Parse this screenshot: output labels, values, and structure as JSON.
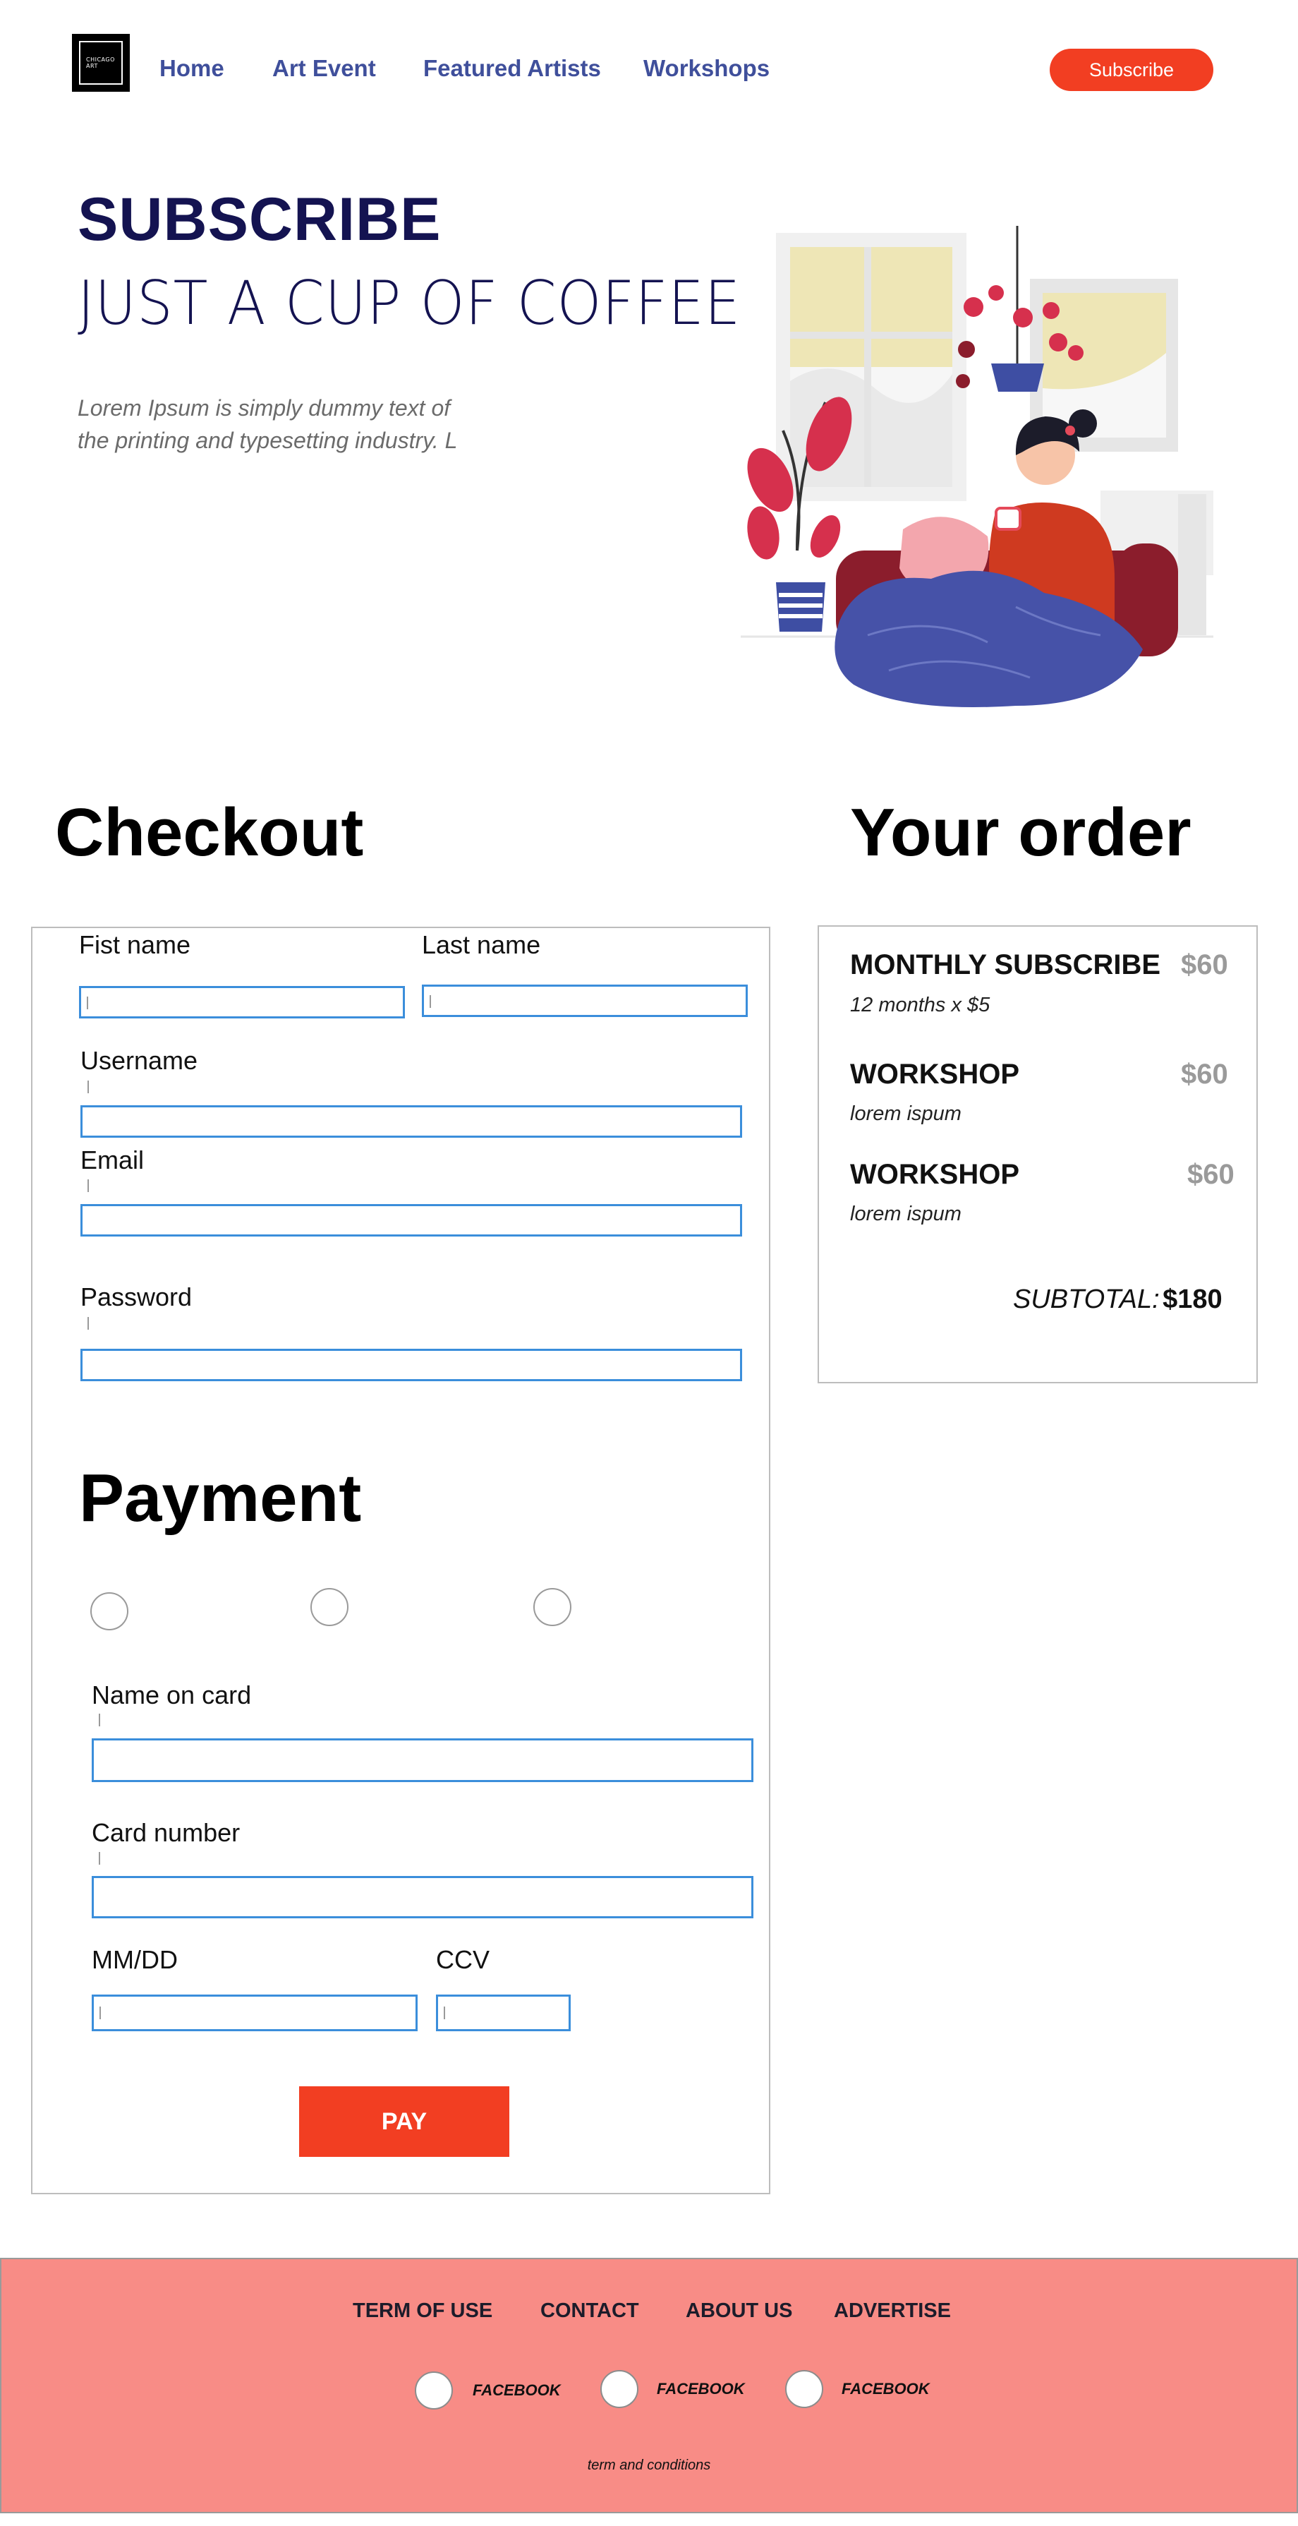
{
  "colors": {
    "accent": "#f23e22",
    "nav_link": "#3f4f9b",
    "hero_text": "#141351",
    "input_border": "#3b8edb",
    "footer_bg": "#f88c86"
  },
  "nav": {
    "logo_line1": "CHICAGO",
    "logo_line2": "ART",
    "links": [
      "Home",
      "Art Event",
      "Featured Artists",
      "Workshops"
    ],
    "subscribe_label": "Subscribe"
  },
  "hero": {
    "title": "SUBSCRIBE",
    "subtitle": "JUST A CUP OF COFFEE",
    "description": "Lorem Ipsum is simply dummy text of the printing and typesetting industry. L"
  },
  "checkout": {
    "title": "Checkout",
    "first_name_label": "Fist name",
    "last_name_label": "Last name",
    "username_label": "Username",
    "email_label": "Email",
    "password_label": "Password"
  },
  "payment": {
    "title": "Payment",
    "name_on_card_label": "Name on card",
    "card_number_label": "Card number",
    "expiry_label": "MM/DD",
    "ccv_label": "CCV",
    "pay_label": "PAY"
  },
  "order": {
    "title": "Your order",
    "items": [
      {
        "name": "MONTHLY SUBSCRIBE",
        "price": "$60",
        "desc": "12 months x $5"
      },
      {
        "name": "WORKSHOP",
        "price": "$60",
        "desc": "lorem ispum"
      },
      {
        "name": "WORKSHOP",
        "price": "$60",
        "desc": "lorem ispum"
      }
    ],
    "subtotal_label": "SUBTOTAL:",
    "subtotal_value": "$180"
  },
  "footer": {
    "links": [
      "TERM OF USE",
      "CONTACT",
      "ABOUT US",
      "ADVERTISE"
    ],
    "social": [
      "FACEBOOK",
      "FACEBOOK",
      "FACEBOOK"
    ],
    "terms": "term and conditions"
  }
}
